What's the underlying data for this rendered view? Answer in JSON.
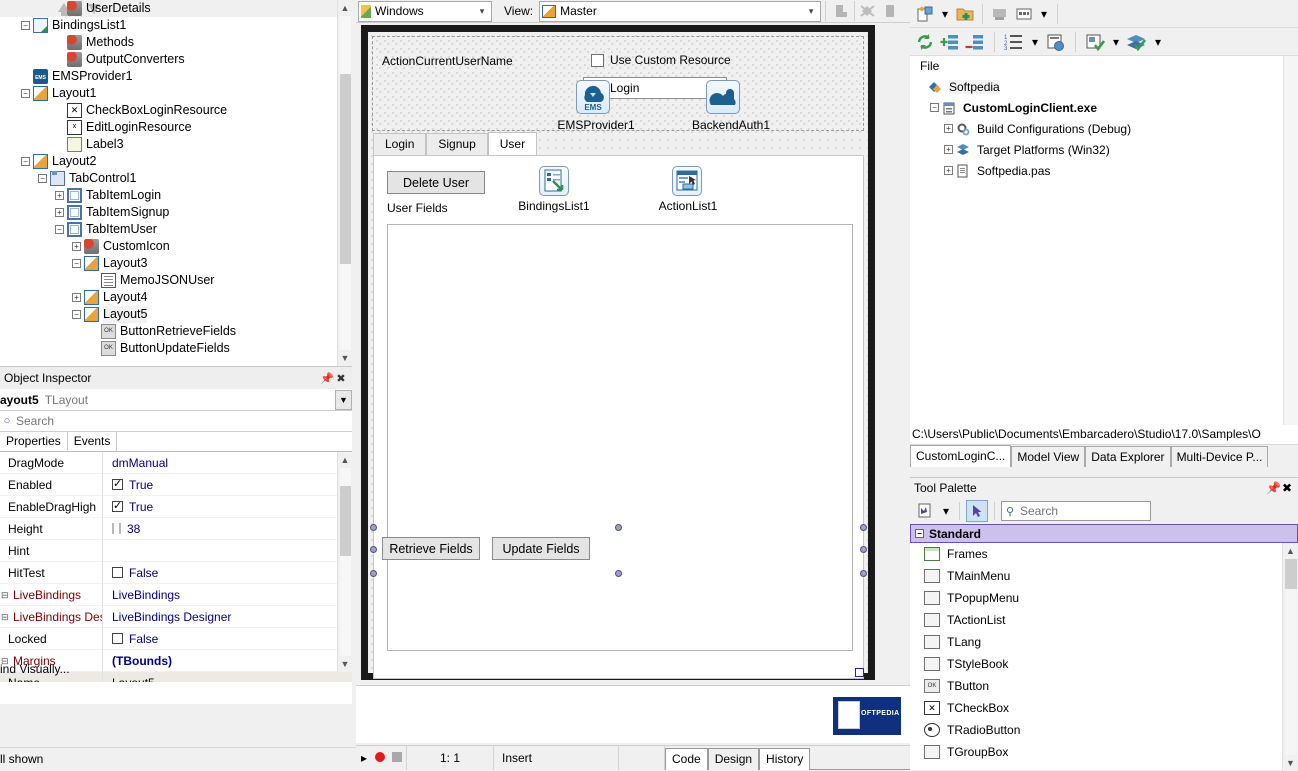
{
  "structure": {
    "nodes": [
      {
        "label": "UserDetails",
        "indent": 3,
        "icon": "method",
        "expander": "none"
      },
      {
        "label": "BindingsList1",
        "indent": 1,
        "icon": "bindings",
        "expander": "minus"
      },
      {
        "label": "Methods",
        "indent": 3,
        "icon": "method",
        "expander": "none"
      },
      {
        "label": "OutputConverters",
        "indent": 3,
        "icon": "method",
        "expander": "none"
      },
      {
        "label": "EMSProvider1",
        "indent": 1,
        "icon": "ems",
        "expander": "none"
      },
      {
        "label": "Layout1",
        "indent": 1,
        "icon": "layout",
        "expander": "minus"
      },
      {
        "label": "CheckBoxLoginResource",
        "indent": 3,
        "icon": "checkbox",
        "expander": "none"
      },
      {
        "label": "EditLoginResource",
        "indent": 3,
        "icon": "edit",
        "expander": "none"
      },
      {
        "label": "Label3",
        "indent": 3,
        "icon": "label",
        "expander": "none"
      },
      {
        "label": "Layout2",
        "indent": 1,
        "icon": "layout",
        "expander": "minus"
      },
      {
        "label": "TabControl1",
        "indent": 2,
        "icon": "tabctrl",
        "expander": "minus"
      },
      {
        "label": "TabItemLogin",
        "indent": 3,
        "icon": "tabitem",
        "expander": "plus"
      },
      {
        "label": "TabItemSignup",
        "indent": 3,
        "icon": "tabitem",
        "expander": "plus"
      },
      {
        "label": "TabItemUser",
        "indent": 3,
        "icon": "tabitem",
        "expander": "minus"
      },
      {
        "label": "CustomIcon",
        "indent": 4,
        "icon": "method",
        "expander": "plus"
      },
      {
        "label": "Layout3",
        "indent": 4,
        "icon": "layout",
        "expander": "minus"
      },
      {
        "label": "MemoJSONUser",
        "indent": 5,
        "icon": "memo",
        "expander": "none"
      },
      {
        "label": "Layout4",
        "indent": 4,
        "icon": "layout",
        "expander": "plus"
      },
      {
        "label": "Layout5",
        "indent": 4,
        "icon": "layout",
        "expander": "minus",
        "selected": true
      },
      {
        "label": "ButtonRetrieveFields",
        "indent": 5,
        "icon": "button",
        "expander": "none"
      },
      {
        "label": "ButtonUpdateFields",
        "indent": 5,
        "icon": "button",
        "expander": "none"
      }
    ]
  },
  "object_inspector": {
    "title": "Object Inspector",
    "pin_icon": "pin-icon",
    "close_icon": "close-icon",
    "selected_name": "ayout5",
    "selected_type": "TLayout",
    "search_placeholder": "Search",
    "tabs": [
      {
        "label": "Properties",
        "active": true
      },
      {
        "label": "Events",
        "active": false
      }
    ],
    "rows": [
      {
        "key": "DragMode",
        "value": "dmManual",
        "kind": "text"
      },
      {
        "key": "Enabled",
        "value": "True",
        "kind": "checkbox",
        "checked": true
      },
      {
        "key": "EnableDragHigh",
        "value": "True",
        "kind": "checkbox",
        "checked": true
      },
      {
        "key": "Height",
        "value": "38",
        "kind": "height"
      },
      {
        "key": "Hint",
        "value": "",
        "kind": "text"
      },
      {
        "key": "HitTest",
        "value": "False",
        "kind": "checkbox",
        "checked": false
      },
      {
        "key": "LiveBindings",
        "value": "LiveBindings",
        "kind": "text",
        "nested": true
      },
      {
        "key": "LiveBindings Des",
        "value": "LiveBindings Designer",
        "kind": "text",
        "nested": true
      },
      {
        "key": "Locked",
        "value": "False",
        "kind": "checkbox",
        "checked": false
      },
      {
        "key": "Margins",
        "value": "(TBounds)",
        "kind": "bold",
        "nested": true
      },
      {
        "key": "Name",
        "value": "Layout5",
        "kind": "text",
        "selected": true
      }
    ],
    "bind_visually": "ind Visually...",
    "all_shown": "ll shown"
  },
  "designer": {
    "platform_combo": "Windows",
    "view_label": "View:",
    "view_combo": "Master",
    "form": {
      "action_label": "ActionCurrentUserName",
      "custom_resource_checkbox": "Use Custom Resource",
      "custom_resource_checked": false,
      "edit_value": "tomLogin",
      "components": [
        {
          "name": "EMSProvider1",
          "icon": "ems-cloud-icon"
        },
        {
          "name": "BackendAuth1",
          "icon": "cloud-lock-icon"
        }
      ],
      "tabs": [
        {
          "label": "Login",
          "active": false
        },
        {
          "label": "Signup",
          "active": false
        },
        {
          "label": "User",
          "active": true
        }
      ],
      "delete_user_button": "Delete User",
      "user_fields_label": "User Fields",
      "nonvisual": [
        {
          "name": "BindingsList1",
          "icon": "bindings-list-icon"
        },
        {
          "name": "ActionList1",
          "icon": "action-list-icon"
        }
      ],
      "retrieve_button": "Retrieve Fields",
      "update_button": "Update Fields"
    },
    "status": {
      "position": "1:  1",
      "mode": "Insert",
      "tabs": [
        {
          "label": "Code",
          "active": false
        },
        {
          "label": "Design",
          "active": true
        },
        {
          "label": "History",
          "active": false
        }
      ]
    }
  },
  "project_manager": {
    "header": "File",
    "nodes": [
      {
        "label": "Softpedia",
        "level": 0,
        "icon": "project-group-icon",
        "expander": "none",
        "bold": false,
        "selected": true
      },
      {
        "label": "CustomLoginClient.exe",
        "level": 1,
        "icon": "project-icon",
        "expander": "minus",
        "bold": true
      },
      {
        "label": "Build Configurations (Debug)",
        "level": 2,
        "icon": "gear-icon",
        "expander": "plus",
        "bold": false
      },
      {
        "label": "Target Platforms (Win32)",
        "level": 2,
        "icon": "layers-icon",
        "expander": "plus",
        "bold": false
      },
      {
        "label": "Softpedia.pas",
        "level": 2,
        "icon": "pas-file-icon",
        "expander": "plus",
        "bold": false
      }
    ],
    "path": "C:\\Users\\Public\\Documents\\Embarcadero\\Studio\\17.0\\Samples\\O",
    "tabs": [
      {
        "label": "CustomLoginC...",
        "active": true
      },
      {
        "label": "Model View",
        "active": false
      },
      {
        "label": "Data Explorer",
        "active": false
      },
      {
        "label": "Multi-Device P...",
        "active": false
      }
    ]
  },
  "tool_palette": {
    "title": "Tool Palette",
    "pin_icon": "pin-icon",
    "close_icon": "close-icon",
    "search_placeholder": "Search",
    "category": "Standard",
    "items": [
      {
        "label": "Frames",
        "icon": "frame-icon",
        "style": "box"
      },
      {
        "label": "TMainMenu",
        "icon": "main-menu-icon",
        "style": "grey"
      },
      {
        "label": "TPopupMenu",
        "icon": "popup-menu-icon",
        "style": "grey"
      },
      {
        "label": "TActionList",
        "icon": "action-list-icon",
        "style": "grey"
      },
      {
        "label": "TLang",
        "icon": "lang-icon",
        "style": "grey"
      },
      {
        "label": "TStyleBook",
        "icon": "style-book-icon",
        "style": "grey"
      },
      {
        "label": "TButton",
        "icon": "button-icon",
        "style": "ok"
      },
      {
        "label": "TCheckBox",
        "icon": "checkbox-icon",
        "style": "x"
      },
      {
        "label": "TRadioButton",
        "icon": "radio-icon",
        "style": "radio"
      },
      {
        "label": "TGroupBox",
        "icon": "group-box-icon",
        "style": "grey"
      }
    ]
  },
  "watermark": {
    "text": "OFTPEDIA"
  },
  "colors": {
    "accent": "#2b6ca3",
    "category": "#ccc0ec",
    "value_text": "#000080",
    "nested_key": "#7a0000"
  }
}
